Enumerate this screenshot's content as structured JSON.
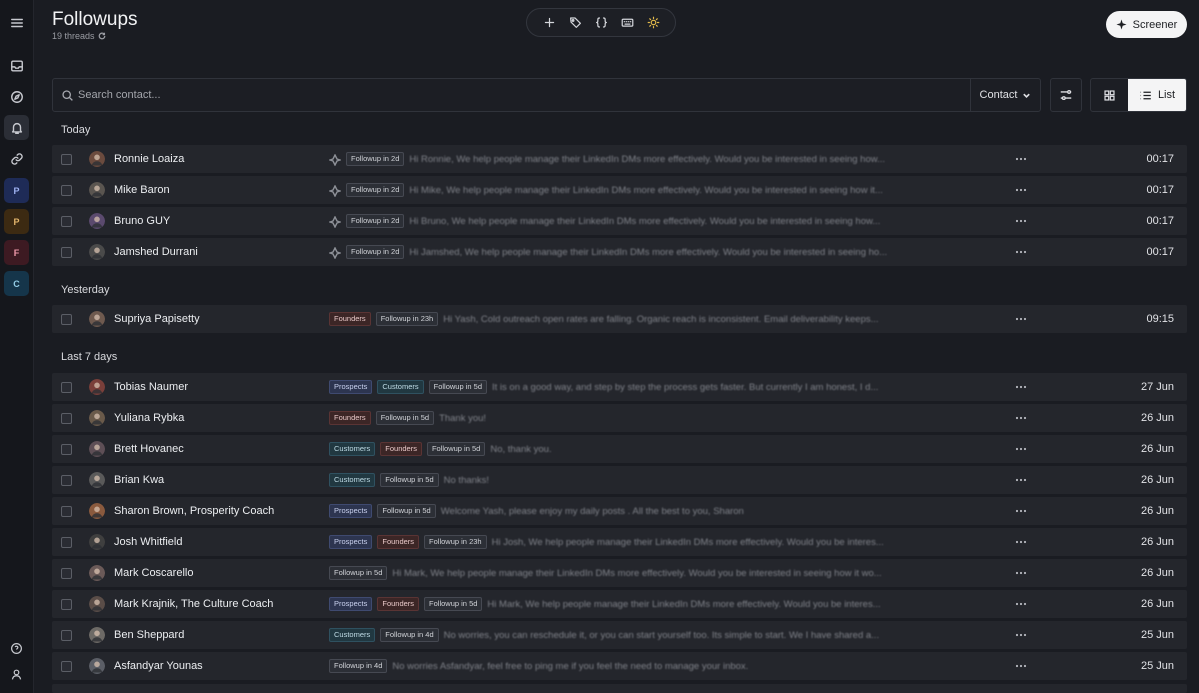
{
  "header": {
    "title": "Followups",
    "thread_count": "19 threads"
  },
  "toolbar": {
    "icons": [
      "plus-icon",
      "tag-icon",
      "braces-icon",
      "keyboard-icon",
      "sun-icon"
    ]
  },
  "screener_label": "Screener",
  "search": {
    "placeholder": "Search contact...",
    "value": ""
  },
  "contact_select": "Contact",
  "view_toggle": {
    "list_label": "List",
    "active": "list"
  },
  "rail": {
    "workspaces": [
      {
        "letter": "P",
        "color": "#1e2b57",
        "text_color": "#9fb2f2"
      },
      {
        "letter": "P",
        "color": "#3c2a12",
        "text_color": "#e2b56c"
      },
      {
        "letter": "F",
        "color": "#3d1a22",
        "text_color": "#f09aab"
      },
      {
        "letter": "C",
        "color": "#15354a",
        "text_color": "#93cde6"
      }
    ]
  },
  "groups": [
    {
      "label": "Today",
      "rows": [
        {
          "name": "Ronnie Loaiza",
          "tags": [],
          "followup": "Followup in 2d",
          "preview": "Hi Ronnie, We help people manage their LinkedIn DMs more effectively. Would you be interested in seeing how...",
          "time": "00:17",
          "starred": true
        },
        {
          "name": "Mike Baron",
          "tags": [],
          "followup": "Followup in 2d",
          "preview": "Hi Mike, We help people manage their LinkedIn DMs more effectively. Would you be interested in seeing how it...",
          "time": "00:17",
          "starred": true
        },
        {
          "name": "Bruno GUY",
          "tags": [],
          "followup": "Followup in 2d",
          "preview": "Hi Bruno, We help people manage their LinkedIn DMs more effectively. Would you be interested in seeing how...",
          "time": "00:17",
          "starred": true
        },
        {
          "name": "Jamshed Durrani",
          "tags": [],
          "followup": "Followup in 2d",
          "preview": "Hi Jamshed, We help people manage their LinkedIn DMs more effectively. Would you be interested in seeing ho...",
          "time": "00:17",
          "starred": true
        }
      ]
    },
    {
      "label": "Yesterday",
      "rows": [
        {
          "name": "Supriya Papisetty",
          "tags": [
            "Founders"
          ],
          "followup": "Followup in 23h",
          "preview": "Hi Yash, Cold outreach open rates are falling. Organic reach is inconsistent. Email deliverability keeps...",
          "time": "09:15",
          "starred": false
        }
      ]
    },
    {
      "label": "Last 7 days",
      "rows": [
        {
          "name": "Tobias Naumer",
          "tags": [
            "Prospects",
            "Customers"
          ],
          "followup": "Followup in 5d",
          "preview": "It is on a good way, and step by step the process gets faster. But currently I am honest, I d...",
          "time": "27 Jun",
          "starred": false
        },
        {
          "name": "Yuliana Rybka",
          "tags": [
            "Founders"
          ],
          "followup": "Followup in 5d",
          "preview": "Thank you!",
          "time": "26 Jun",
          "starred": false
        },
        {
          "name": "Brett Hovanec",
          "tags": [
            "Customers",
            "Founders"
          ],
          "followup": "Followup in 5d",
          "preview": "No, thank you.",
          "time": "26 Jun",
          "starred": false
        },
        {
          "name": "Brian Kwa",
          "tags": [
            "Customers"
          ],
          "followup": "Followup in 5d",
          "preview": "No thanks!",
          "time": "26 Jun",
          "starred": false
        },
        {
          "name": "Sharon Brown, Prosperity Coach",
          "tags": [
            "Prospects"
          ],
          "followup": "Followup in 5d",
          "preview": "Welcome Yash, please enjoy my daily posts . All the best to you, Sharon",
          "time": "26 Jun",
          "starred": false
        },
        {
          "name": "Josh Whitfield",
          "tags": [
            "Prospects",
            "Founders"
          ],
          "followup": "Followup in 23h",
          "preview": "Hi Josh, We help people manage their LinkedIn DMs more effectively. Would you be interes...",
          "time": "26 Jun",
          "starred": false
        },
        {
          "name": "Mark Coscarello",
          "tags": [],
          "followup": "Followup in 5d",
          "preview": "Hi Mark, We help people manage their LinkedIn DMs more effectively. Would you be interested in seeing how it wo...",
          "time": "26 Jun",
          "starred": false
        },
        {
          "name": "Mark Krajnik, The Culture Coach",
          "tags": [
            "Prospects",
            "Founders"
          ],
          "followup": "Followup in 5d",
          "preview": "Hi Mark, We help people manage their LinkedIn DMs more effectively. Would you be interes...",
          "time": "26 Jun",
          "starred": false
        },
        {
          "name": "Ben Sheppard",
          "tags": [
            "Customers"
          ],
          "followup": "Followup in 4d",
          "preview": "No worries, you can reschedule it, or you can start yourself too. Its simple to start. We I have shared a...",
          "time": "25 Jun",
          "starred": false
        },
        {
          "name": "Asfandyar Younas",
          "tags": [],
          "followup": "Followup in 4d",
          "preview": "No worries Asfandyar, feel free to ping me if you feel the need to manage your inbox.",
          "time": "25 Jun",
          "starred": false
        }
      ]
    }
  ]
}
